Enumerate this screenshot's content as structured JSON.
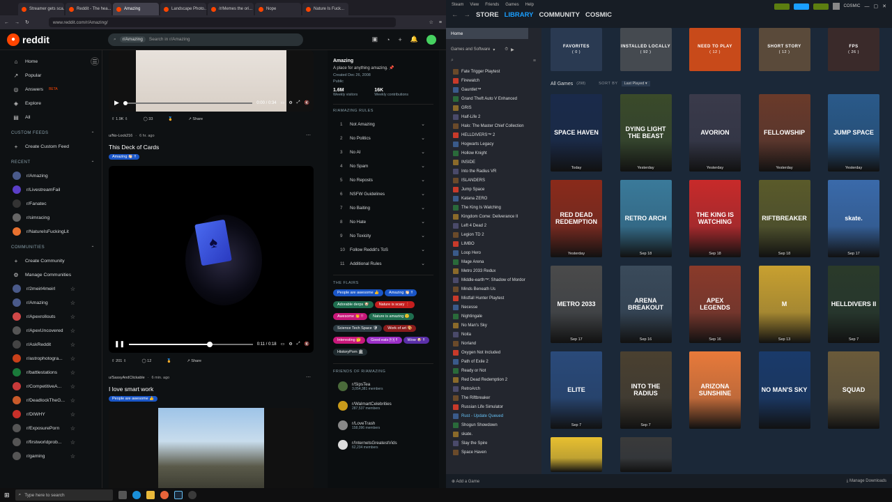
{
  "firefox": {
    "tabs": [
      "Streamer gets sca...",
      "Reddit - The hea...",
      "Amazing",
      "Landscape Photo...",
      "/r/Memes the ori...",
      "Nope",
      "Nature Is Fuck..."
    ],
    "active_tab": 2,
    "url": "www.reddit.com/r/Amazing/"
  },
  "reddit": {
    "logo": "reddit",
    "search_chip": "r/Amazing",
    "search_placeholder": "Search in r/Amazing",
    "nav": [
      {
        "label": "Home",
        "icon": "home-icon"
      },
      {
        "label": "Popular",
        "icon": "popular-icon"
      },
      {
        "label": "Answers",
        "icon": "answers-icon",
        "badge": "BETA"
      },
      {
        "label": "Explore",
        "icon": "explore-icon"
      },
      {
        "label": "All",
        "icon": "all-icon"
      }
    ],
    "custom_feeds_header": "CUSTOM FEEDS",
    "create_custom_feed": "Create Custom Feed",
    "recent_header": "RECENT",
    "recent": [
      {
        "name": "r/Amazing",
        "color": "#4a5a8a"
      },
      {
        "name": "r/LivestreamFail",
        "color": "#5b3fc8"
      },
      {
        "name": "r/Fanatec",
        "color": "#333333"
      },
      {
        "name": "r/simracing",
        "color": "#666666"
      },
      {
        "name": "r/NatureIsFuckingLit",
        "color": "#e8712f"
      }
    ],
    "communities_header": "COMMUNITIES",
    "create_community": "Create Community",
    "manage_communities": "Manage Communities",
    "communities": [
      {
        "name": "r/2meirl4meirl",
        "color": "#4a5a8a"
      },
      {
        "name": "r/Amazing",
        "color": "#4a5a8a"
      },
      {
        "name": "r/Apexrollouts",
        "color": "#d04848"
      },
      {
        "name": "r/ApexUncovered",
        "color": "#555555"
      },
      {
        "name": "r/AskReddit",
        "color": "#444444"
      },
      {
        "name": "r/astrophotogra...",
        "color": "#c8401a"
      },
      {
        "name": "r/battlestations",
        "color": "#1a7a3a"
      },
      {
        "name": "r/CompetitiveA...",
        "color": "#c83a3a"
      },
      {
        "name": "r/DeadlockTheG...",
        "color": "#c85a2a"
      },
      {
        "name": "r/DIWHY",
        "color": "#c8302a"
      },
      {
        "name": "r/ExposurePorn",
        "color": "#555555"
      },
      {
        "name": "r/firstworldprob...",
        "color": "#555555"
      },
      {
        "name": "r/gaming",
        "color": "#555555"
      }
    ],
    "post1": {
      "time": "0:00 / 0:34",
      "votes": "1.9K",
      "comments": "33",
      "share": "Share"
    },
    "post2": {
      "author": "u/No-Lock216",
      "age": "6 hr. ago",
      "title": "This Deck of Cards",
      "flair": "Amazing 👏🏻 !!",
      "time": "0:11 / 0:18",
      "progress": 0.65,
      "votes": "201",
      "comments": "12",
      "share": "Share"
    },
    "post3": {
      "author": "u/SassyAndClickable",
      "age": "6 min. ago",
      "title": "I love smart work",
      "flair": "People are awesome 👍"
    },
    "about": {
      "name": "Amazing",
      "desc": "A place for anything amazing. 📌",
      "created": "Created Dec 26, 2008",
      "visibility": "Public",
      "visitors_value": "1.6M",
      "visitors_label": "Weekly visitors",
      "contrib_value": "16K",
      "contrib_label": "Weekly contributions"
    },
    "rules_header": "R/AMAZING RULES",
    "rules": [
      "Not Amazing",
      "No Politics",
      "No AI",
      "No Spam",
      "No Reposts",
      "NSFW Guidelines",
      "No Baiting",
      "No Hate",
      "No Toxicity",
      "Follow Reddit's ToS",
      "Additional Rules"
    ],
    "flairs_header": "THE FLAIRS",
    "flairs": [
      {
        "label": "People are awesome 👍",
        "color": "#1a56c7"
      },
      {
        "label": "Amazing 👏🏻 !!",
        "color": "#1a56c7"
      },
      {
        "label": "Adorable derps 🐶",
        "color": "#1f6e4f"
      },
      {
        "label": "Nature is scary ❗",
        "color": "#c41e1e"
      },
      {
        "label": "Awesome 👏 !!",
        "color": "#c8187a"
      },
      {
        "label": "Nature is amazing 🙂",
        "color": "#1f6e4f"
      },
      {
        "label": "Science Tech Space 🛡",
        "color": "#2e3d44"
      },
      {
        "label": "Work of art 🎨",
        "color": "#8a1c1c"
      },
      {
        "label": "Interesting 🤔",
        "color": "#c8187a"
      },
      {
        "label": "Good eats 🍽 !!",
        "color": "#9b2fc7"
      },
      {
        "label": "Wow 🐶 !!",
        "color": "#5a2fa8"
      },
      {
        "label": "HistoryPorn 🏛",
        "color": "#1f2a2e"
      }
    ],
    "friends_header": "FRIENDS OF R/AMAZING",
    "friends": [
      {
        "name": "r/SipsTea",
        "members": "3,054,381 members",
        "color": "#4a6a3a"
      },
      {
        "name": "r/WalmartCelebrities",
        "members": "287,537 members",
        "color": "#c89a1a"
      },
      {
        "name": "r/LoveTrash",
        "members": "158,096 members",
        "color": "#888888"
      },
      {
        "name": "r/InternetsGreatestVids",
        "members": "62,234 members",
        "color": "#dddddd"
      }
    ]
  },
  "steam": {
    "menu": [
      "Steam",
      "View",
      "Friends",
      "Games",
      "Help"
    ],
    "nav": [
      "STORE",
      "LIBRARY",
      "COMMUNITY",
      "COSMIC"
    ],
    "home": "Home",
    "filter_label": "Games and Software",
    "games": [
      "Fate Trigger Playtest",
      "Firewatch",
      "Gauntlet™",
      "Grand Theft Auto V Enhanced",
      "GRIS",
      "Half-Life 2",
      "Halo: The Master Chief Collection",
      "HELLDIVERS™ 2",
      "Hogwarts Legacy",
      "Hollow Knight",
      "INSIDE",
      "Into the Radius VR",
      "ISLANDERS",
      "Jump Space",
      "Katana ZERO",
      "The King Is Watching",
      "Kingdom Come: Deliverance II",
      "Left 4 Dead 2",
      "Legion TD 2",
      "LIMBO",
      "Loop Hero",
      "Mage Arena",
      "Metro 2033 Redux",
      "Middle-earth™: Shadow of Mordor",
      "Minds Beneath Us",
      "Mistfall Hunter Playtest",
      "Necesse",
      "Nightingale",
      "No Man's Sky",
      "Noita",
      "Norland",
      "Oxygen Not Included",
      "Path of Exile 2",
      "Ready or Not",
      "Red Dead Redemption 2",
      "RetroArch",
      "The Riftbreaker",
      "Russian Life Simulator",
      "Rust - Update Queued",
      "Shogun Showdown",
      "skate.",
      "Slay the Spire",
      "Space Haven"
    ],
    "collections": [
      {
        "title": "FAVORITES",
        "count": "( 0 )",
        "color": "#2a3a52"
      },
      {
        "title": "INSTALLED LOCALLY",
        "count": "( 92 )",
        "color": "#454a50"
      },
      {
        "title": "NEED TO PLAY",
        "count": "( 12 )",
        "color": "#c84a1a"
      },
      {
        "title": "SHORT STORY",
        "count": "( 12 )",
        "color": "#5a4a3a"
      },
      {
        "title": "FPS",
        "count": "( 26 )",
        "color": "#3a2a2a"
      }
    ],
    "all_games": "All Games",
    "all_games_count": "(298)",
    "sort_by": "SORT BY",
    "sort_value": "Last Played",
    "captures": [
      {
        "title": "SPACE HAVEN",
        "date": "Today",
        "bg": "#1a2a4a"
      },
      {
        "title": "DYING LIGHT THE BEAST",
        "date": "Yesterday",
        "bg": "#3a4a2a"
      },
      {
        "title": "AVORION",
        "date": "Yesterday",
        "bg": "#3a3a4a"
      },
      {
        "title": "FELLOWSHIP",
        "date": "Yesterday",
        "bg": "#6a3a2a"
      },
      {
        "title": "JUMP SPACE",
        "date": "Yesterday",
        "bg": "#2a5a8a"
      },
      {
        "title": "RED DEAD REDEMPTION",
        "date": "Yesterday",
        "bg": "#8a2a1a"
      },
      {
        "title": "RETRO ARCH",
        "date": "Sep 18",
        "bg": "#3a7a9a"
      },
      {
        "title": "THE KING IS WATCHING",
        "date": "Sep 18",
        "bg": "#c82a2a"
      },
      {
        "title": "RIFTBREAKER",
        "date": "Sep 18",
        "bg": "#5a5a2a"
      },
      {
        "title": "skate.",
        "date": "Sep 17",
        "bg": "#3a6aaa"
      },
      {
        "title": "METRO 2033",
        "date": "Sep 17",
        "bg": "#4a4a4a"
      },
      {
        "title": "ARENA BREAKOUT",
        "date": "Sep 16",
        "bg": "#3a4a5a"
      },
      {
        "title": "APEX LEGENDS",
        "date": "Sep 16",
        "bg": "#8a3a2a"
      },
      {
        "title": "M",
        "date": "Sep 13",
        "bg": "#c8a030"
      },
      {
        "title": "HELLDIVERS II",
        "date": "Sep 7",
        "bg": "#2a3a2a"
      },
      {
        "title": "ELITE",
        "date": "Sep 7",
        "bg": "#2a4a7a"
      },
      {
        "title": "INTO THE RADIUS",
        "date": "Sep 7",
        "bg": "#4a4030"
      },
      {
        "title": "ARIZONA SUNSHINE",
        "date": "",
        "bg": "#e87a3a"
      },
      {
        "title": "NO MAN'S SKY",
        "date": "",
        "bg": "#1a3a6a"
      },
      {
        "title": "SQUAD",
        "date": "",
        "bg": "#6a5a3a"
      },
      {
        "title": "",
        "date": "",
        "bg": "#e8c030"
      },
      {
        "title": "",
        "date": "",
        "bg": "#3a3a3a"
      }
    ],
    "add_game": "Add a Game",
    "manage_downloads": "Manage Downloads"
  },
  "taskbar": {
    "search": "Type here to search"
  }
}
